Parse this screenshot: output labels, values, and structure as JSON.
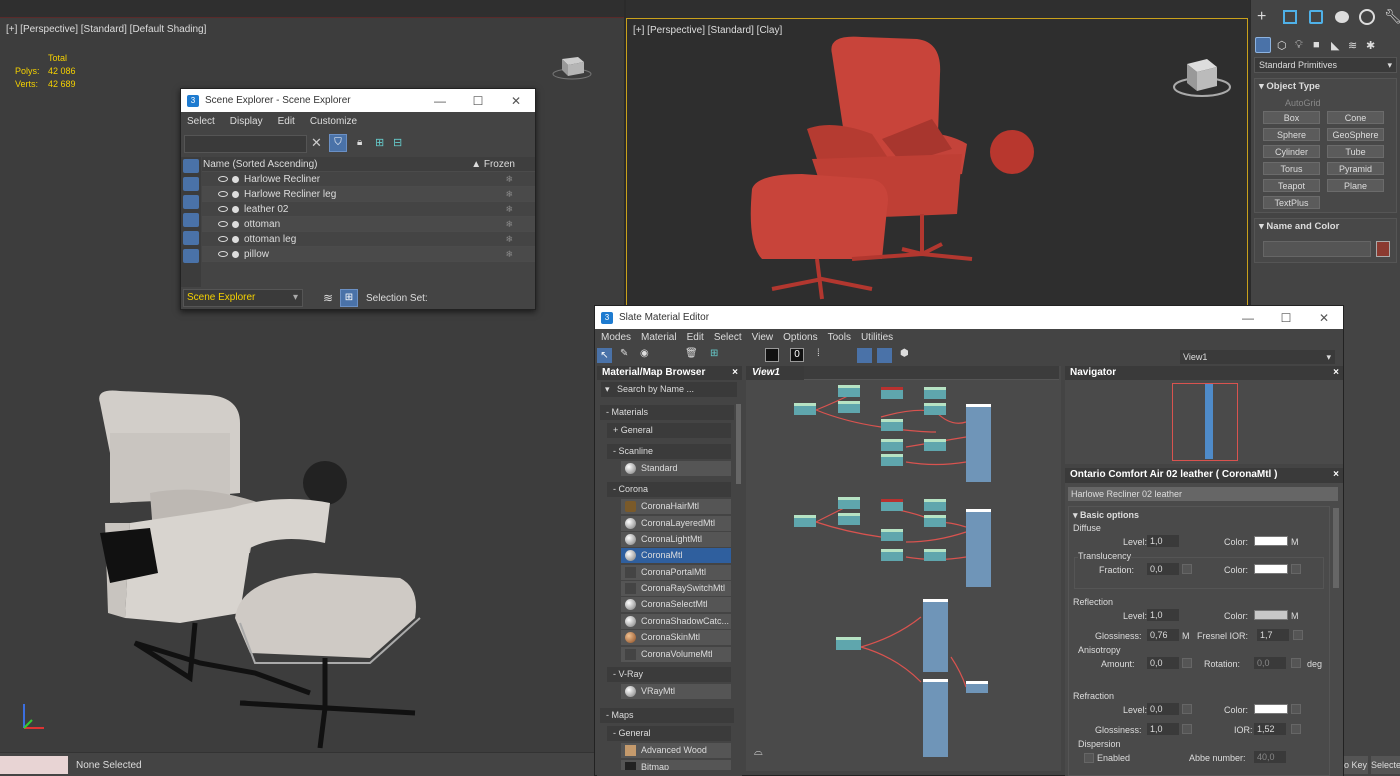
{
  "top_left_vp": {
    "label": "[+] [Perspective] [Standard] [Default Shading]",
    "stats": {
      "total": "Total",
      "polys_label": "Polys:",
      "polys": "42 086",
      "verts_label": "Verts:",
      "verts": "42 689"
    }
  },
  "top_right_vp": {
    "label": "[+] [Perspective] [Standard] [Clay]"
  },
  "scene_explorer": {
    "title": "Scene Explorer - Scene Explorer",
    "menu": [
      "Select",
      "Display",
      "Edit",
      "Customize"
    ],
    "col_name": "Name (Sorted Ascending)",
    "col_frozen": "▲ Frozen",
    "items": [
      "Harlowe Recliner",
      "Harlowe Recliner leg",
      "leather 02",
      "ottoman",
      "ottoman leg",
      "pillow"
    ],
    "footer_dropdown": "Scene Explorer",
    "selection_set": "Selection Set:"
  },
  "command_panel": {
    "dropdown": "Standard Primitives",
    "object_type": "Object Type",
    "autogrid": "AutoGrid",
    "buttons": [
      "Box",
      "Cone",
      "Sphere",
      "GeoSphere",
      "Cylinder",
      "Tube",
      "Torus",
      "Pyramid",
      "Teapot",
      "Plane",
      "TextPlus"
    ],
    "name_and_color": "Name and Color"
  },
  "slate": {
    "title": "Slate Material Editor",
    "menu": [
      "Modes",
      "Material",
      "Edit",
      "Select",
      "View",
      "Options",
      "Tools",
      "Utilities"
    ],
    "view_dropdown": "View1",
    "browser": {
      "title": "Material/Map Browser",
      "search_placeholder": "Search by Name ...",
      "materials": "- Materials",
      "general": "+ General",
      "scanline": "- Scanline",
      "standard": "Standard",
      "corona": "- Corona",
      "corona_items": [
        "CoronaHairMtl",
        "CoronaLayeredMtl",
        "CoronaLightMtl",
        "CoronaMtl",
        "CoronaPortalMtl",
        "CoronaRaySwitchMtl",
        "CoronaSelectMtl",
        "CoronaShadowCatc...",
        "CoronaSkinMtl",
        "CoronaVolumeMtl"
      ],
      "vray": "- V-Ray",
      "vray_item": "VRayMtl",
      "maps": "- Maps",
      "maps_general": "- General",
      "advanced_wood": "Advanced Wood",
      "bitmap": "Bitmap"
    },
    "view_tab": "View1",
    "navigator": "Navigator",
    "param": {
      "title": "Ontario Comfort Air 02 leather  ( CoronaMtl )",
      "material_name": "Harlowe Recliner 02 leather",
      "basic_options": "Basic options",
      "diffuse": "Diffuse",
      "level": "Level:",
      "color": "Color:",
      "m": "M",
      "translucency": "Translucency",
      "fraction": "Fraction:",
      "reflection": "Reflection",
      "glossiness": "Glossiness:",
      "fresnel": "Fresnel IOR:",
      "anisotropy": "Anisotropy",
      "amount": "Amount:",
      "rotation": "Rotation:",
      "deg": "deg",
      "refraction": "Refraction",
      "ior": "IOR:",
      "dispersion": "Dispersion",
      "enabled": "Enabled",
      "abbe": "Abbe number:",
      "v_1_0": "1,0",
      "v_0_0": "0,0",
      "v_0_76": "0,76",
      "v_1_7": "1,7",
      "v_1_52": "1,52",
      "v_40_0": "40,0"
    }
  },
  "status": {
    "none_selected": "None Selected",
    "key": "o Key",
    "select": "Selecte"
  },
  "colors": {
    "viewport": "#3d3d3d",
    "panel": "#444444",
    "selection": "#2f5f9e",
    "chair_red": "#c8443a",
    "chair_grey": "#cbc7c2"
  }
}
